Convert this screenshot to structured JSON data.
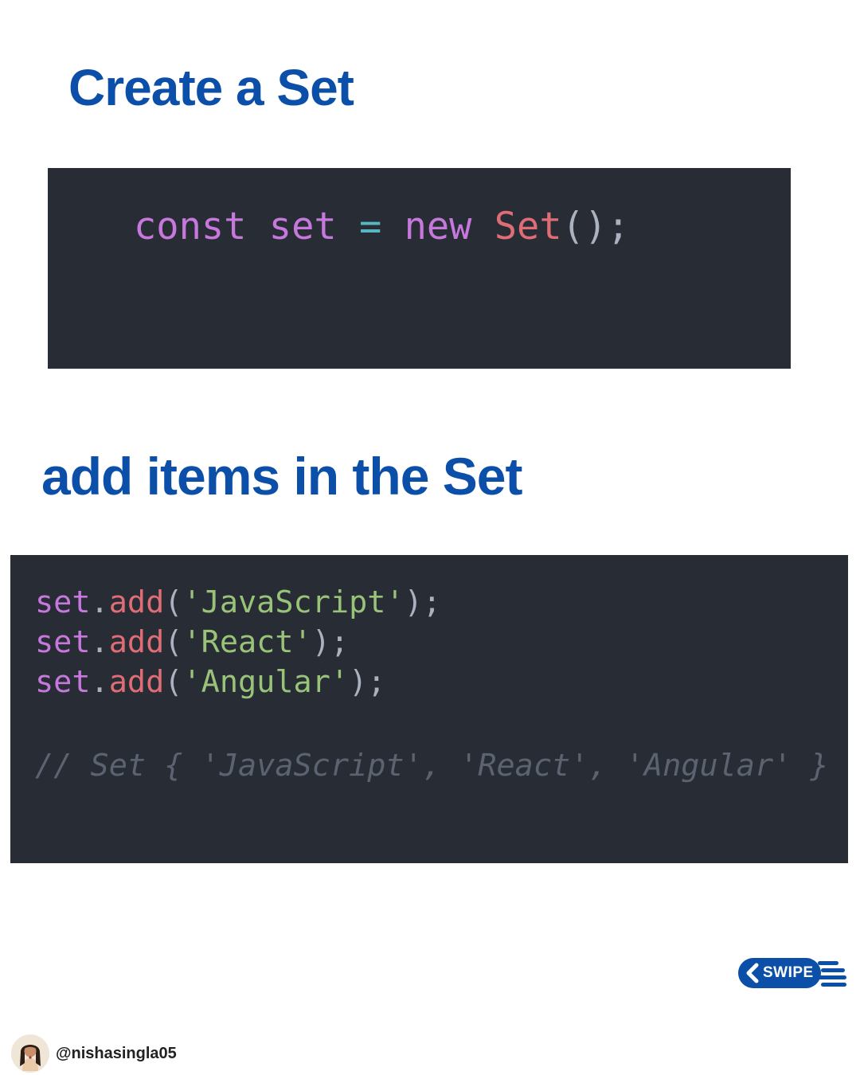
{
  "colors": {
    "background": "#ffffff",
    "heading": "#0b4fa8",
    "code_background": "#282c34",
    "keyword": "#c678dd",
    "operator": "#56b6c2",
    "class_name": "#e06c75",
    "punctuation": "#abb2bf",
    "method": "#e06c75",
    "string": "#98c379",
    "comment": "#5c6370",
    "badge": "#0b4fa8"
  },
  "section_1": {
    "title": "Create a Set",
    "code": {
      "keyword": "const",
      "variable": "set",
      "operator": "=",
      "new_keyword": "new",
      "class_name": "Set",
      "punct": "();"
    }
  },
  "section_2": {
    "title": "add items in the Set",
    "lines": [
      {
        "object": "set",
        "dot": ".",
        "method": "add",
        "open": "(",
        "string": "'JavaScript'",
        "close": ");"
      },
      {
        "object": "set",
        "dot": ".",
        "method": "add",
        "open": "(",
        "string": "'React'",
        "close": ");"
      },
      {
        "object": "set",
        "dot": ".",
        "method": "add",
        "open": "(",
        "string": "'Angular'",
        "close": ");"
      }
    ],
    "comment": "// Set { 'JavaScript', 'React', 'Angular' }"
  },
  "swipe": {
    "label": "SWIPE",
    "icon": "chevron-left-icon"
  },
  "author": {
    "handle": "@nishasingla05",
    "avatar_icon": "avatar"
  }
}
